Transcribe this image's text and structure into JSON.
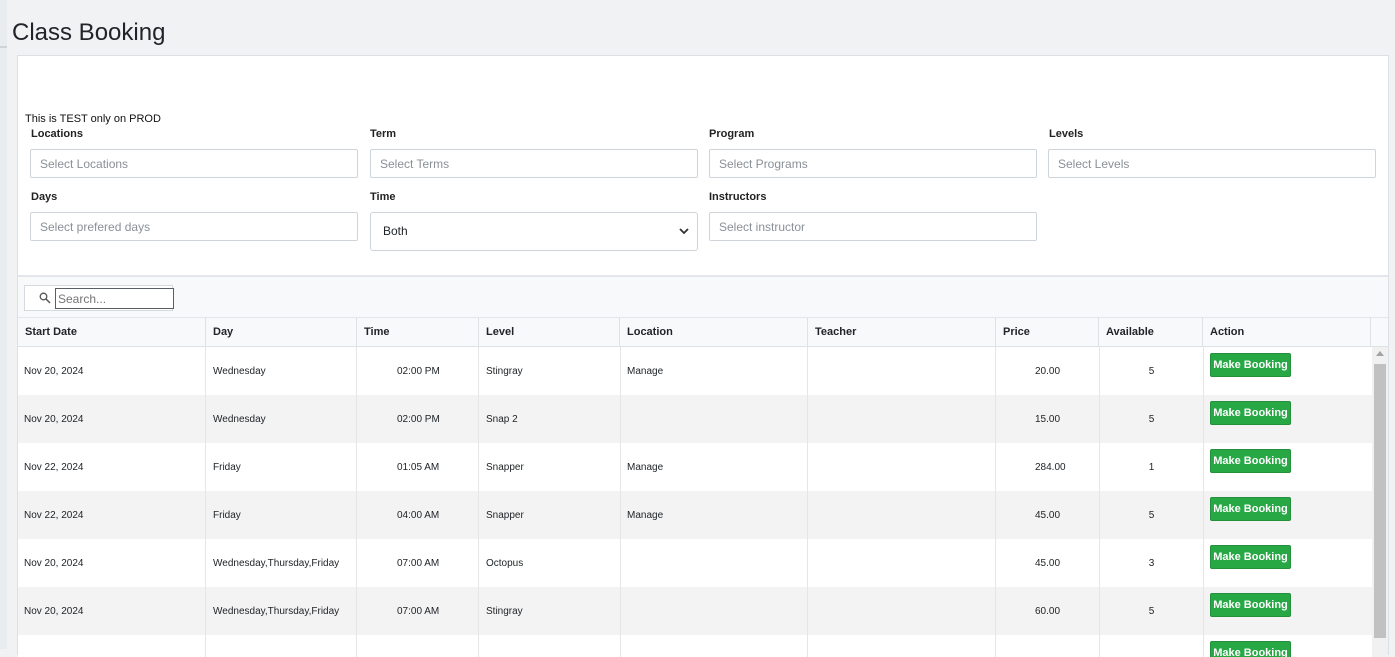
{
  "page_title": "Class Booking",
  "notice": "This is TEST only on PROD",
  "filters": {
    "locations": {
      "label": "Locations",
      "placeholder": "Select Locations"
    },
    "term": {
      "label": "Term",
      "placeholder": "Select Terms"
    },
    "program": {
      "label": "Program",
      "placeholder": "Select Programs"
    },
    "levels": {
      "label": "Levels",
      "placeholder": "Select Levels"
    },
    "days": {
      "label": "Days",
      "placeholder": "Select prefered days"
    },
    "time": {
      "label": "Time",
      "value": "Both"
    },
    "instructors": {
      "label": "Instructors",
      "placeholder": "Select instructor"
    }
  },
  "search": {
    "placeholder": "Search..."
  },
  "table": {
    "columns": [
      "Start Date",
      "Day",
      "Time",
      "Level",
      "Location",
      "Teacher",
      "Price",
      "Available",
      "Action"
    ],
    "rows": [
      {
        "start_date": "Nov 20, 2024",
        "day": "Wednesday",
        "time": "02:00 PM",
        "level": "Stingray",
        "location": "Manage",
        "teacher": "",
        "price": "20.00",
        "available": "5",
        "action": "Make Booking"
      },
      {
        "start_date": "Nov 20, 2024",
        "day": "Wednesday",
        "time": "02:00 PM",
        "level": "Snap 2",
        "location": "",
        "teacher": "",
        "price": "15.00",
        "available": "5",
        "action": "Make Booking"
      },
      {
        "start_date": "Nov 22, 2024",
        "day": "Friday",
        "time": "01:05 AM",
        "level": "Snapper",
        "location": "Manage",
        "teacher": "",
        "price": "284.00",
        "available": "1",
        "action": "Make Booking"
      },
      {
        "start_date": "Nov 22, 2024",
        "day": "Friday",
        "time": "04:00 AM",
        "level": "Snapper",
        "location": "Manage",
        "teacher": "",
        "price": "45.00",
        "available": "5",
        "action": "Make Booking"
      },
      {
        "start_date": "Nov 20, 2024",
        "day": "Wednesday,Thursday,Friday",
        "time": "07:00 AM",
        "level": "Octopus",
        "location": "",
        "teacher": "",
        "price": "45.00",
        "available": "3",
        "action": "Make Booking"
      },
      {
        "start_date": "Nov 20, 2024",
        "day": "Wednesday,Thursday,Friday",
        "time": "07:00 AM",
        "level": "Stingray",
        "location": "",
        "teacher": "",
        "price": "60.00",
        "available": "5",
        "action": "Make Booking"
      },
      {
        "start_date": "",
        "day": "",
        "time": "",
        "level": "",
        "location": "",
        "teacher": "",
        "price": "",
        "available": "",
        "action": "Make Booking"
      }
    ]
  },
  "colors": {
    "primary_button": "#28a745",
    "row_stripe": "#f3f3f3"
  },
  "icons": {
    "search": "search-icon",
    "select": "chevron-down-icon"
  }
}
